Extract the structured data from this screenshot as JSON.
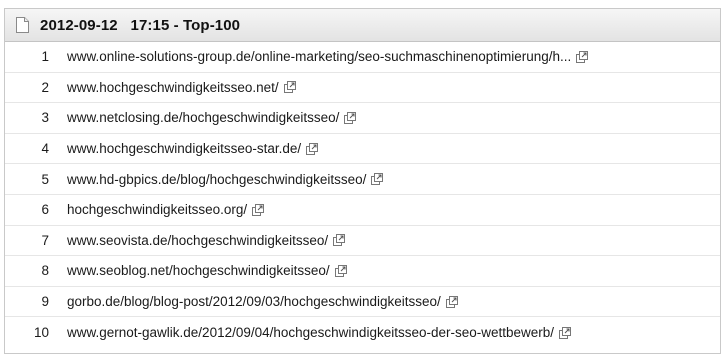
{
  "header": {
    "title": "2012-09-12   17:15 - Top-100",
    "icon": "document-icon"
  },
  "results": [
    {
      "rank": "1",
      "url": "www.online-solutions-group.de/online-marketing/seo-suchmaschinenoptimierung/h..."
    },
    {
      "rank": "2",
      "url": "www.hochgeschwindigkeitsseo.net/"
    },
    {
      "rank": "3",
      "url": "www.netclosing.de/hochgeschwindigkeitsseo/"
    },
    {
      "rank": "4",
      "url": "www.hochgeschwindigkeitsseo-star.de/"
    },
    {
      "rank": "5",
      "url": "www.hd-gbpics.de/blog/hochgeschwindigkeitsseo/"
    },
    {
      "rank": "6",
      "url": "hochgeschwindigkeitsseo.org/"
    },
    {
      "rank": "7",
      "url": "www.seovista.de/hochgeschwindigkeitsseo/"
    },
    {
      "rank": "8",
      "url": "www.seoblog.net/hochgeschwindigkeitsseo/"
    },
    {
      "rank": "9",
      "url": "gorbo.de/blog/blog-post/2012/09/03/hochgeschwindigkeitsseo/"
    },
    {
      "rank": "10",
      "url": "www.gernot-gawlik.de/2012/09/04/hochgeschwindigkeitsseo-der-seo-wettbewerb/"
    }
  ],
  "icons": {
    "external_link": "external-link-icon"
  }
}
